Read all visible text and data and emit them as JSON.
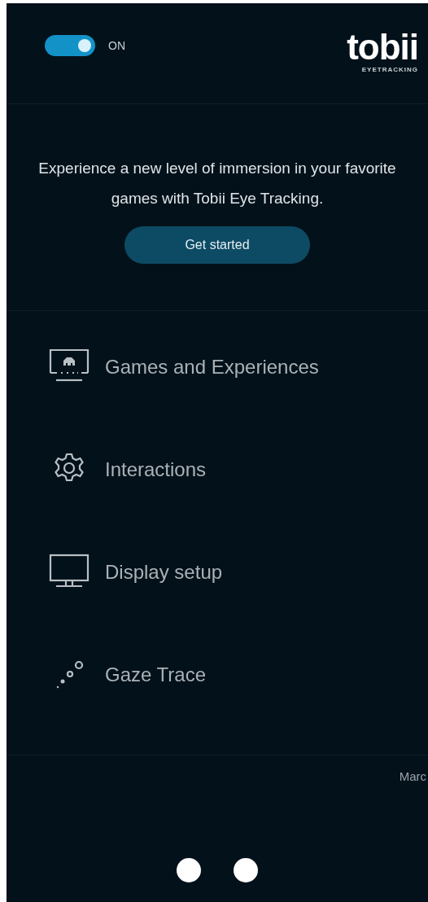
{
  "header": {
    "toggle": {
      "on": true,
      "label": "ON"
    },
    "logo": {
      "name": "tobii",
      "tagline": "EYETRACKING"
    }
  },
  "promo": {
    "text": "Experience a new level of immersion in your favorite games with Tobii Eye Tracking.",
    "button": "Get started"
  },
  "menu": [
    {
      "kind": "games",
      "label": "Games and Experiences"
    },
    {
      "kind": "gear",
      "label": "Interactions"
    },
    {
      "kind": "display",
      "label": "Display setup"
    },
    {
      "kind": "gaze",
      "label": "Gaze Trace"
    }
  ],
  "footer": {
    "user": "Marc"
  }
}
